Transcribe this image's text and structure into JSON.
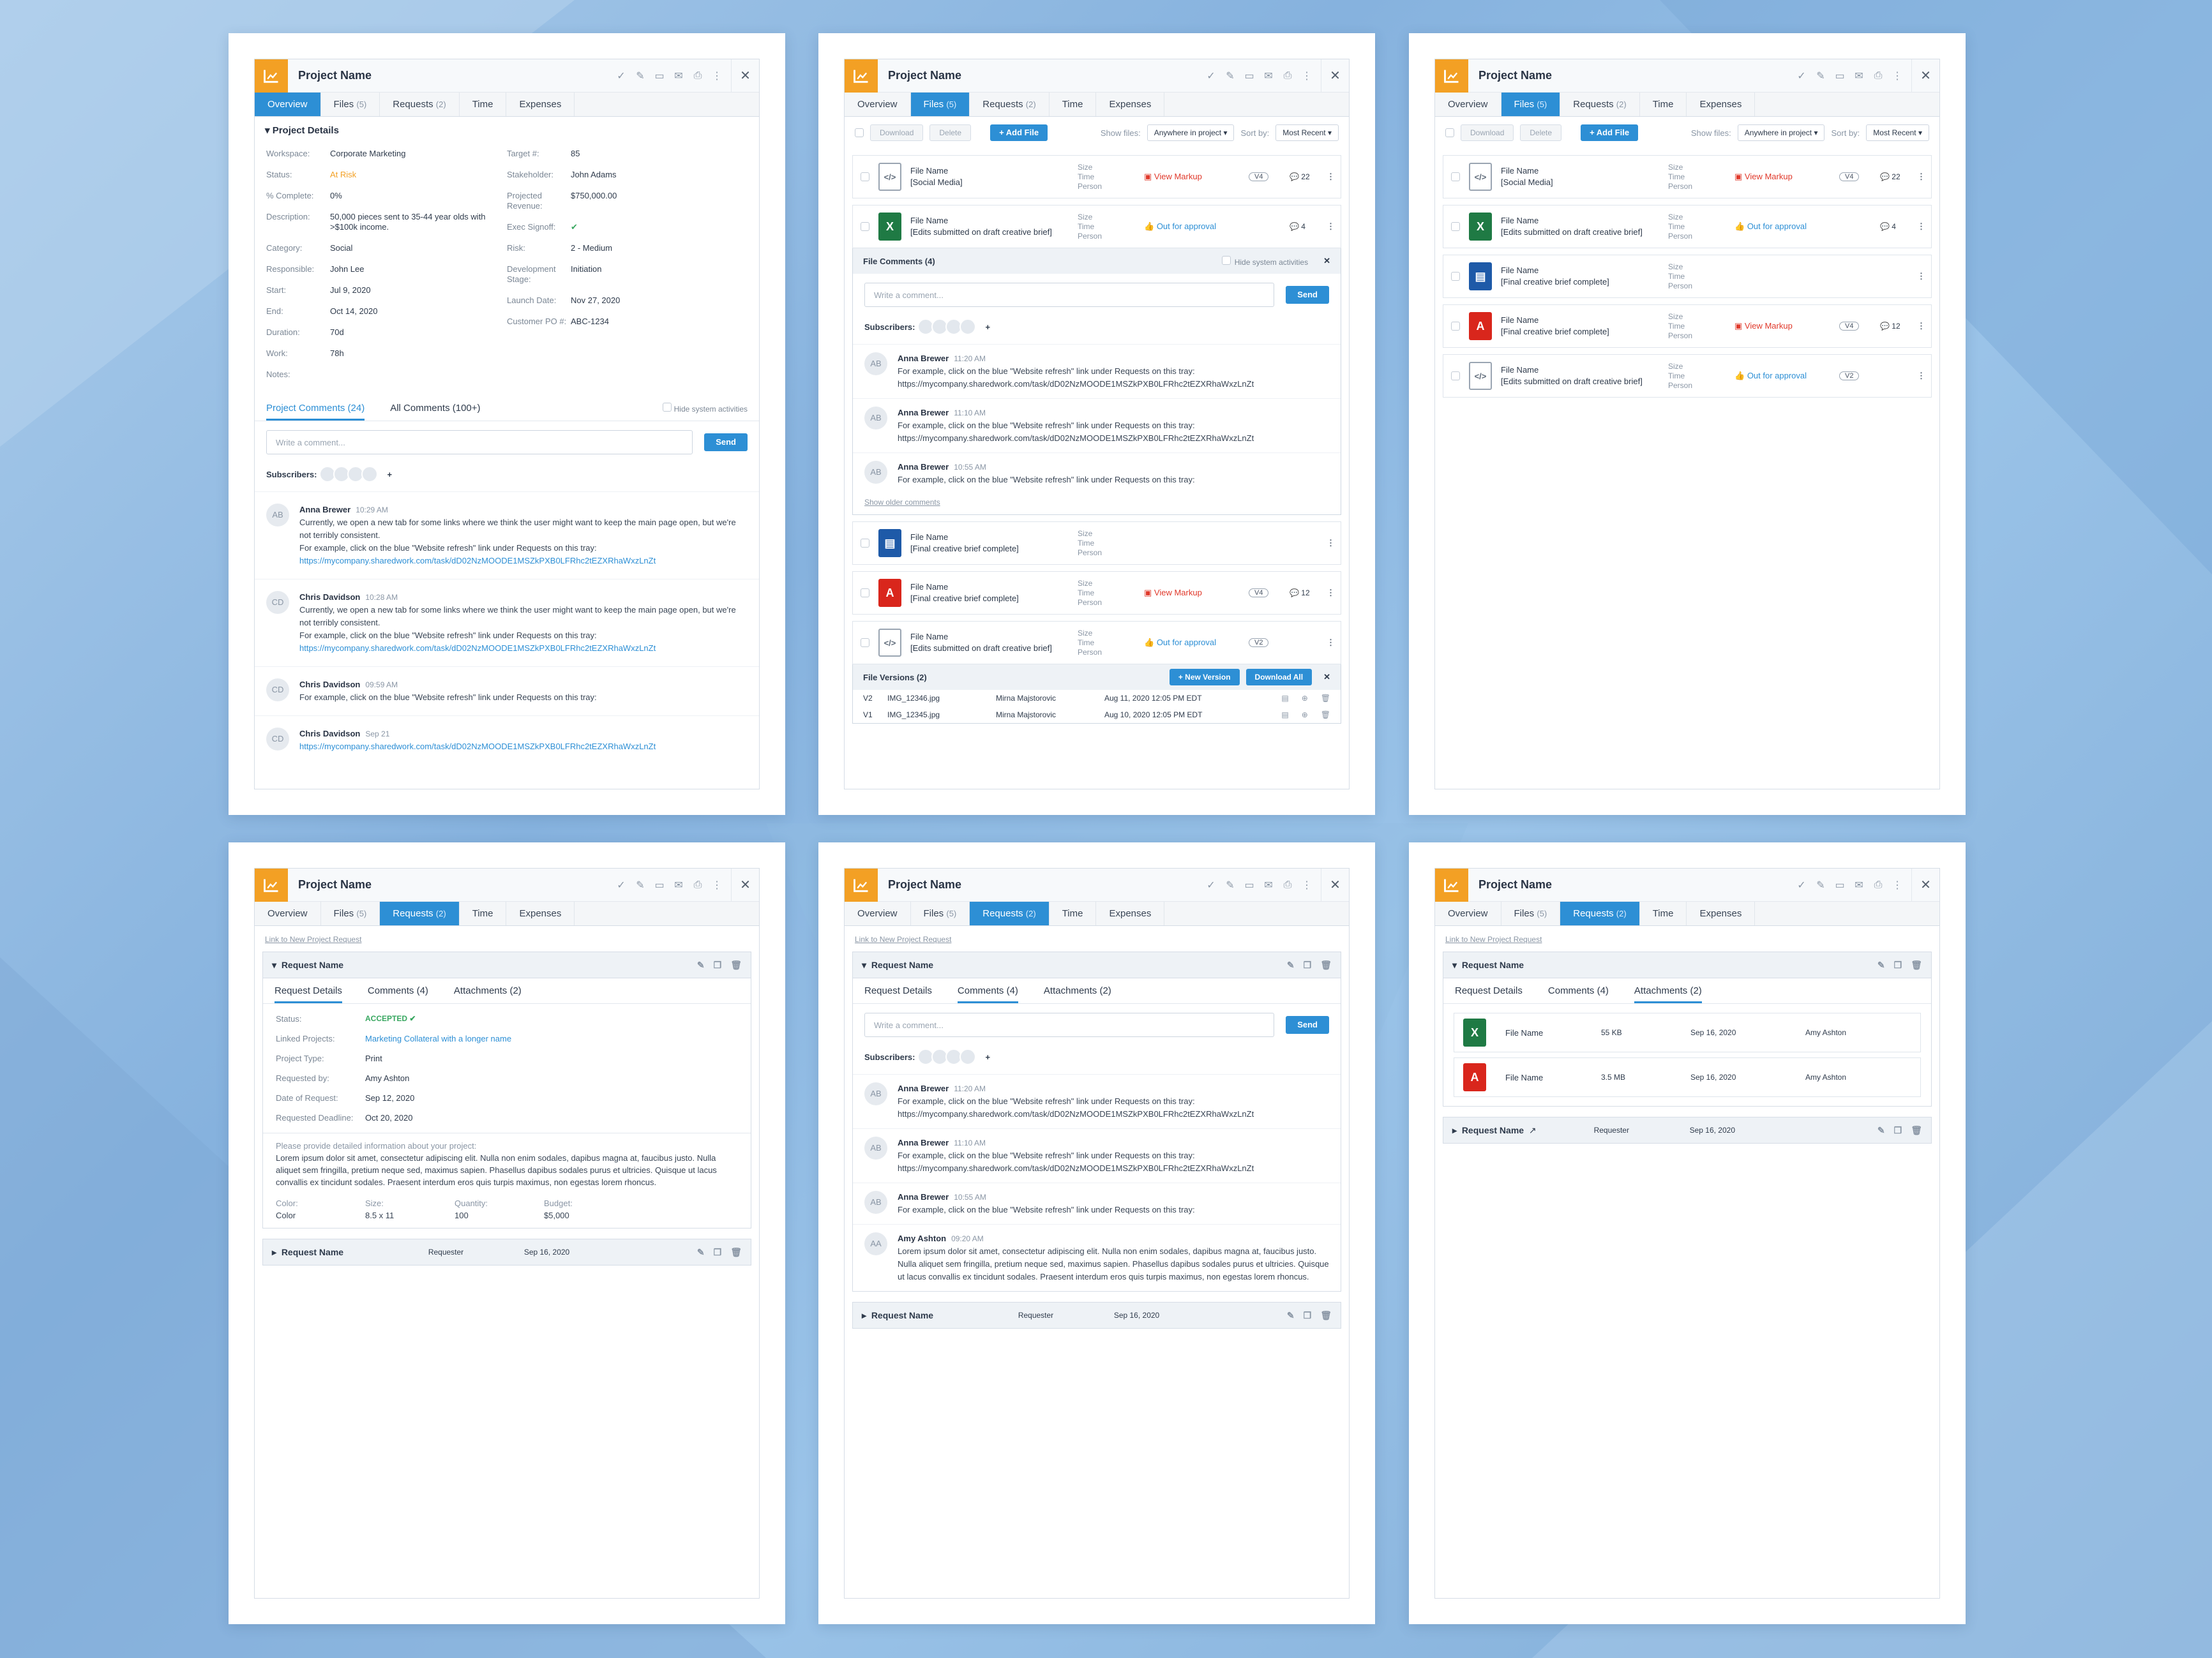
{
  "app": {
    "project_name": "Project Name",
    "tabs": [
      {
        "label": "Overview",
        "count": ""
      },
      {
        "label": "Files",
        "count": "(5)"
      },
      {
        "label": "Requests",
        "count": "(2)"
      },
      {
        "label": "Time",
        "count": ""
      },
      {
        "label": "Expenses",
        "count": ""
      }
    ]
  },
  "overview": {
    "section_title": "Project Details",
    "left": [
      {
        "label": "Workspace:",
        "value": "Corporate Marketing"
      },
      {
        "label": "Status:",
        "value": "At Risk"
      },
      {
        "label": "% Complete:",
        "value": "0%"
      },
      {
        "label": "Description:",
        "value": "50,000 pieces sent to 35-44 year olds with >$100k income."
      },
      {
        "label": "Category:",
        "value": "Social"
      },
      {
        "label": "Responsible:",
        "value": "John Lee"
      },
      {
        "label": "Start:",
        "value": "Jul 9, 2020"
      },
      {
        "label": "End:",
        "value": "Oct 14, 2020"
      },
      {
        "label": "Duration:",
        "value": "70d"
      },
      {
        "label": "Work:",
        "value": "78h"
      },
      {
        "label": "Notes:",
        "value": ""
      }
    ],
    "right": [
      {
        "label": "Target #:",
        "value": "85"
      },
      {
        "label": "Stakeholder:",
        "value": "John Adams"
      },
      {
        "label": "Projected Revenue:",
        "value": "$750,000.00"
      },
      {
        "label": "Exec Signoff:",
        "value": "✔"
      },
      {
        "label": "Risk:",
        "value": "2 - Medium"
      },
      {
        "label": "Development Stage:",
        "value": "Initiation"
      },
      {
        "label": "Launch Date:",
        "value": "Nov 27, 2020"
      },
      {
        "label": "Customer PO #:",
        "value": "ABC-1234"
      }
    ],
    "comment_tabs": [
      "Project Comments (24)",
      "All Comments (100+)"
    ],
    "hide_system": "Hide system activities",
    "placeholder": "Write a comment...",
    "send": "Send",
    "subscribers": "Subscribers:",
    "comments": [
      {
        "initials": "AB",
        "name": "Anna Brewer",
        "time": "10:29 AM",
        "text": "Currently, we open a new tab for some links where we think the user might want to keep the main page open, but we're not terribly consistent.",
        "text2": "For example, click on the blue \"Website refresh\" link under Requests on this tray:",
        "link": "https://mycompany.sharedwork.com/task/dD02NzMOODE1MSZkPXB0LFRhc2tEZXRhaWxzLnZt"
      },
      {
        "initials": "CD",
        "name": "Chris Davidson",
        "time": "10:28 AM",
        "text": "Currently, we open a new tab for some links where we think the user might want to keep the main page open, but we're not terribly consistent.",
        "text2": "For example, click on the blue \"Website refresh\" link under Requests on this tray:",
        "link": "https://mycompany.sharedwork.com/task/dD02NzMOODE1MSZkPXB0LFRhc2tEZXRhaWxzLnZt"
      },
      {
        "initials": "CD",
        "name": "Chris Davidson",
        "time": "09:59 AM",
        "text": "For example, click on the blue \"Website refresh\" link under Requests on this tray:",
        "text2": "",
        "link": ""
      },
      {
        "initials": "CD",
        "name": "Chris Davidson",
        "time": "Sep 21",
        "text": "",
        "text2": "",
        "link": "https://mycompany.sharedwork.com/task/dD02NzMOODE1MSZkPXB0LFRhc2tEZXRhaWxzLnZt"
      }
    ]
  },
  "files": {
    "download": "Download",
    "delete": "Delete",
    "add_file": "+ Add File",
    "show_files": "Show files:",
    "show_value": "Anywhere in project",
    "sort_by": "Sort by:",
    "sort_value": "Most Recent",
    "meta": [
      "Size",
      "Time",
      "Person"
    ],
    "items": [
      {
        "type": "code",
        "name": "File Name",
        "sub": "[Social Media]",
        "status": "View Markup",
        "status_kind": "red",
        "ver": "V4",
        "comments": "22"
      },
      {
        "type": "xls",
        "name": "File Name",
        "sub": "[Edits submitted on draft creative brief]",
        "status": "Out for approval",
        "status_kind": "blue",
        "ver": "",
        "comments": "4"
      },
      {
        "type": "img",
        "name": "File Name",
        "sub": "[Final creative brief complete]",
        "status": "",
        "status_kind": "",
        "ver": "",
        "comments": ""
      },
      {
        "type": "pdf",
        "name": "File Name",
        "sub": "[Final creative brief complete]",
        "status": "View Markup",
        "status_kind": "red",
        "ver": "V4",
        "comments": "12"
      },
      {
        "type": "code",
        "name": "File Name",
        "sub": "[Edits submitted on draft creative brief]",
        "status": "Out for approval",
        "status_kind": "blue",
        "ver": "V2",
        "comments": ""
      }
    ],
    "file_comments_title": "File Comments (4)",
    "file_comments": [
      {
        "initials": "AB",
        "name": "Anna Brewer",
        "time": "11:20 AM",
        "text": "For example, click on the blue \"Website refresh\" link under Requests on this tray:",
        "link": "https://mycompany.sharedwork.com/task/dD02NzMOODE1MSZkPXB0LFRhc2tEZXRhaWxzLnZt"
      },
      {
        "initials": "AB",
        "name": "Anna Brewer",
        "time": "11:10 AM",
        "text": "For example, click on the blue \"Website refresh\" link under Requests on this tray:",
        "link": "https://mycompany.sharedwork.com/task/dD02NzMOODE1MSZkPXB0LFRhc2tEZXRhaWxzLnZt"
      },
      {
        "initials": "AB",
        "name": "Anna Brewer",
        "time": "10:55 AM",
        "text": "For example, click on the blue \"Website refresh\" link under Requests on this tray:",
        "link": ""
      }
    ],
    "show_older": "Show older comments",
    "versions_title": "File Versions (2)",
    "new_version": "+ New Version",
    "download_all": "Download All",
    "versions": [
      {
        "v": "V2",
        "file": "IMG_12346.jpg",
        "person": "Mirna Majstorovic",
        "date": "Aug 11, 2020 12:05 PM EDT"
      },
      {
        "v": "V1",
        "file": "IMG_12345.jpg",
        "person": "Mirna Majstorovic",
        "date": "Aug 10, 2020 12:05 PM EDT"
      }
    ]
  },
  "requests": {
    "link_new": "Link to New Project Request",
    "request_name": "Request Name",
    "requester": "Requester",
    "req_date": "Sep 16, 2020",
    "subtabs": [
      "Request Details",
      "Comments (4)",
      "Attachments (2)"
    ],
    "details": [
      {
        "k": "Status:",
        "v": "ACCEPTED ✔"
      },
      {
        "k": "Linked Projects:",
        "v": "Marketing Collateral with a longer name"
      },
      {
        "k": "Project Type:",
        "v": "Print"
      },
      {
        "k": "Requested by:",
        "v": "Amy Ashton"
      },
      {
        "k": "Date of Request:",
        "v": "Sep 12, 2020"
      },
      {
        "k": "Requested Deadline:",
        "v": "Oct 20, 2020"
      }
    ],
    "desc_label": "Please provide detailed information about your project:",
    "desc": "Lorem ipsum dolor sit amet, consectetur adipiscing elit. Nulla non enim sodales, dapibus magna at, faucibus justo. Nulla aliquet sem fringilla, pretium neque sed, maximus sapien. Phasellus dapibus sodales purus et ultricies. Quisque ut lacus convallis ex tincidunt sodales. Praesent interdum eros quis turpis maximus, non egestas lorem rhoncus.",
    "grid_heads": [
      "Color:",
      "Size:",
      "Quantity:",
      "Budget:"
    ],
    "grid_vals": [
      "Color",
      "8.5 x 11",
      "100",
      "$5,000"
    ],
    "comments": [
      {
        "initials": "AB",
        "name": "Anna Brewer",
        "time": "11:20 AM",
        "text": "For example, click on the blue \"Website refresh\" link under Requests on this tray: https://mycompany.sharedwork.com/task/dD02NzMOODE1MSZkPXB0LFRhc2tEZXRhaWxzLnZt"
      },
      {
        "initials": "AB",
        "name": "Anna Brewer",
        "time": "11:10 AM",
        "text": "For example, click on the blue \"Website refresh\" link under Requests on this tray: https://mycompany.sharedwork.com/task/dD02NzMOODE1MSZkPXB0LFRhc2tEZXRhaWxzLnZt"
      },
      {
        "initials": "AB",
        "name": "Anna Brewer",
        "time": "10:55 AM",
        "text": "For example, click on the blue \"Website refresh\" link under Requests on this tray:"
      },
      {
        "initials": "AA",
        "name": "Amy Ashton",
        "time": "09:20 AM",
        "text": "Lorem ipsum dolor sit amet, consectetur adipiscing elit. Nulla non enim sodales, dapibus magna at, faucibus justo. Nulla aliquet sem fringilla, pretium neque sed, maximus sapien. Phasellus dapibus sodales purus et ultricies. Quisque ut lacus convallis ex tincidunt sodales. Praesent interdum eros quis turpis maximus, non egestas lorem rhoncus."
      }
    ],
    "attachments": [
      {
        "type": "xls",
        "name": "File Name",
        "size": "55 KB",
        "date": "Sep 16, 2020",
        "person": "Amy Ashton"
      },
      {
        "type": "pdf",
        "name": "File Name",
        "size": "3.5 MB",
        "date": "Sep 16, 2020",
        "person": "Amy Ashton"
      }
    ]
  }
}
